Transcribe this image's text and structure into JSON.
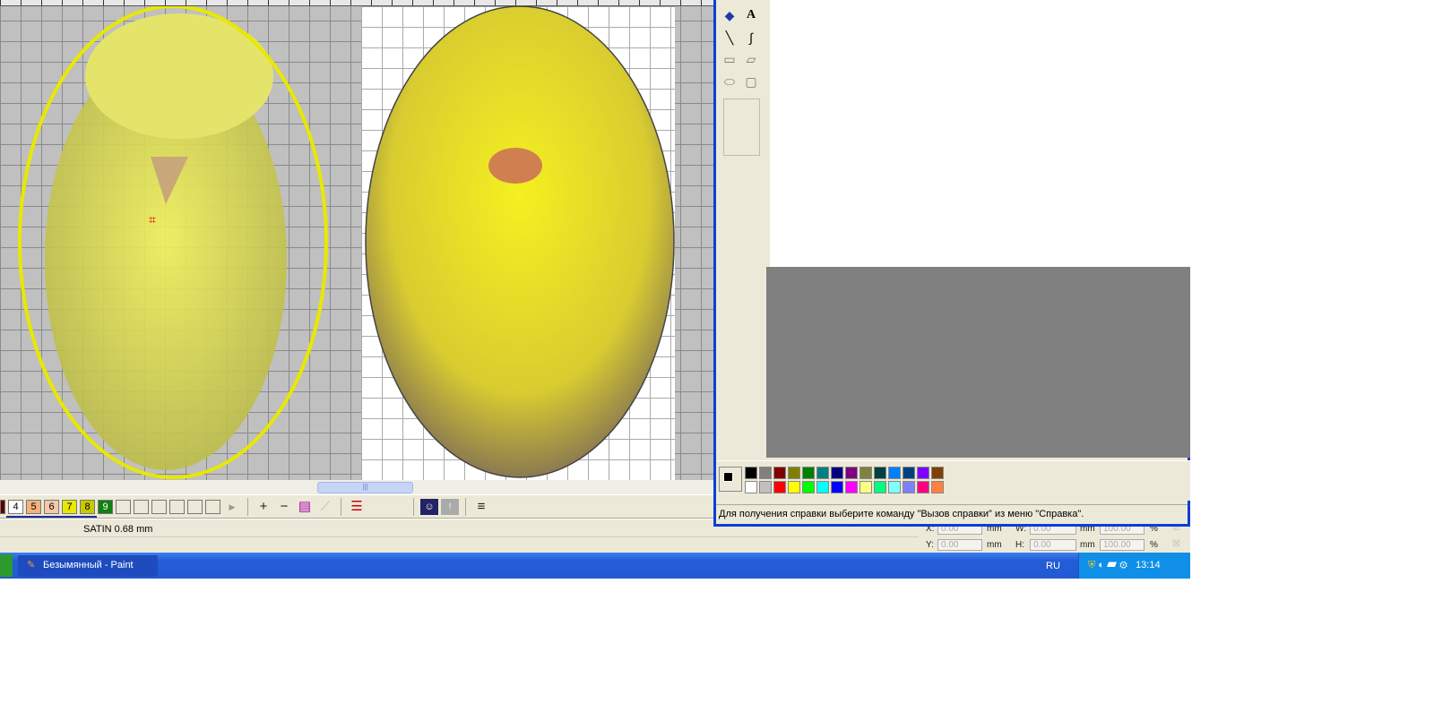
{
  "embroidery": {
    "swatches": [
      {
        "n": "4",
        "c": "#ffffff"
      },
      {
        "n": "5",
        "c": "#f5b07c"
      },
      {
        "n": "6",
        "c": "#f5c8a8"
      },
      {
        "n": "7",
        "c": "#e8e800"
      },
      {
        "n": "8",
        "c": "#c8c800"
      },
      {
        "n": "9",
        "c": "#108010"
      }
    ],
    "status_stitch": "SATIN  0.68 mm",
    "fields": {
      "x_label": "X:",
      "y_label": "Y:",
      "w_label": "W:",
      "h_label": "H:",
      "x": "0.00",
      "y": "0.00",
      "w": "0.00",
      "h": "0.00",
      "unit": "mm",
      "sx": "100.00",
      "sy": "100.00",
      "pct": "%"
    }
  },
  "paint": {
    "status": "Для получения справки выберите команду \"Вызов справки\" из меню \"Справка\".",
    "palette_top": [
      "#000000",
      "#808080",
      "#800000",
      "#808000",
      "#008000",
      "#008080",
      "#000080",
      "#800080",
      "#808040",
      "#004040",
      "#0080ff",
      "#004080",
      "#8000ff",
      "#804000"
    ],
    "palette_bottom": [
      "#ffffff",
      "#c0c0c0",
      "#ff0000",
      "#ffff00",
      "#00ff00",
      "#00ffff",
      "#0000ff",
      "#ff00ff",
      "#ffff80",
      "#00ff80",
      "#80ffff",
      "#8080ff",
      "#ff0080",
      "#ff8040"
    ]
  },
  "taskbar": {
    "task": "Безымянный - Paint",
    "lang": "RU",
    "clock": "13:14"
  }
}
